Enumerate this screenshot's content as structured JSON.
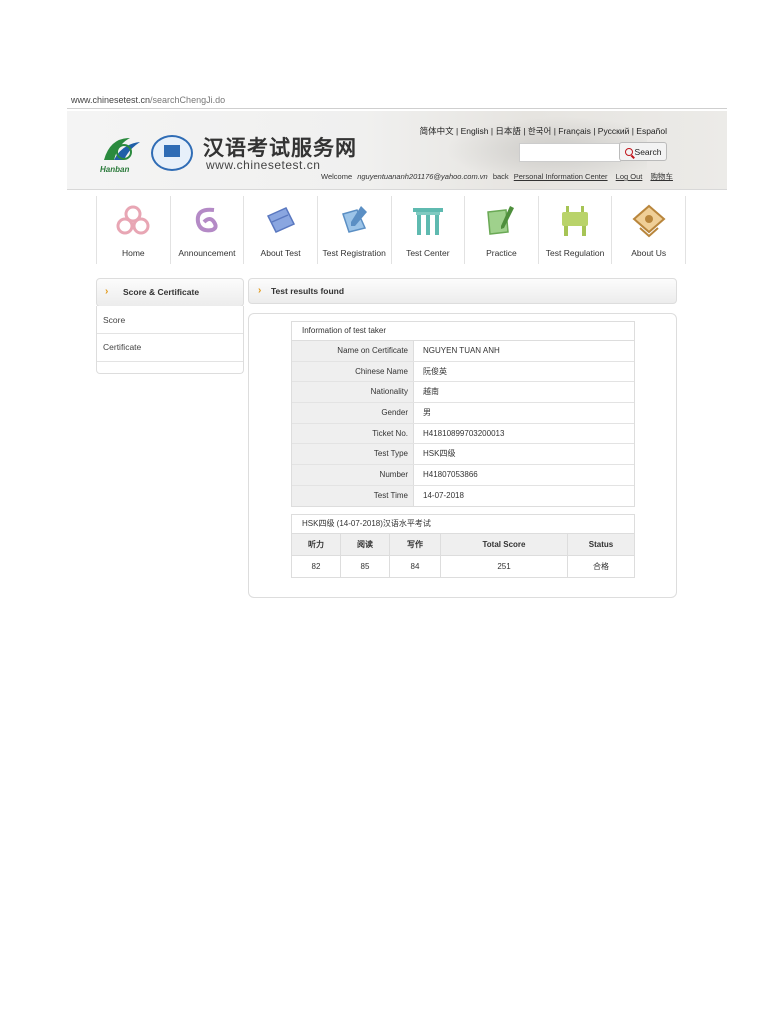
{
  "url": {
    "domain": "www.chinesetest.cn",
    "path": "/searchChengJi.do"
  },
  "header": {
    "logo_text": "Hanban",
    "site_name_cn": "汉语考试服务网",
    "site_name_en": "www.chinesetest.cn",
    "languages": [
      "简体中文",
      "English",
      "日本語",
      "한국어",
      "Français",
      "Русский",
      "Español"
    ],
    "search_button": "Search",
    "search_placeholder": "",
    "welcome": "Welcome",
    "email": "nguyentuananh201176@yahoo.com.vn",
    "back": "back",
    "personal_center": "Personal Information Center",
    "logout": "Log Out",
    "cart": "购物车"
  },
  "nav": {
    "items": [
      {
        "label": "Home",
        "icon": "home-icon",
        "color": "#e8a6b4"
      },
      {
        "label": "Announcement",
        "icon": "announcement-icon",
        "color": "#b48ac6"
      },
      {
        "label": "About Test",
        "icon": "about-test-icon",
        "color": "#6f8fd6"
      },
      {
        "label": "Test Registration",
        "icon": "test-registration-icon",
        "color": "#6fa8dc"
      },
      {
        "label": "Test Center",
        "icon": "test-center-icon",
        "color": "#5fbab0"
      },
      {
        "label": "Practice",
        "icon": "practice-icon",
        "color": "#7fbf6a"
      },
      {
        "label": "Test Regulation",
        "icon": "test-regulation-icon",
        "color": "#a6c455"
      },
      {
        "label": "About Us",
        "icon": "about-us-icon",
        "color": "#d8a75a"
      }
    ]
  },
  "sidebar": {
    "title": "Score & Certificate",
    "items": [
      "Score",
      "Certificate"
    ]
  },
  "main": {
    "title": "Test results found",
    "info": {
      "caption": "Information of test taker",
      "rows": [
        {
          "k": "Name on Certificate",
          "v": "NGUYEN TUAN ANH"
        },
        {
          "k": "Chinese Name",
          "v": "阮俊英"
        },
        {
          "k": "Nationality",
          "v": "越南"
        },
        {
          "k": "Gender",
          "v": "男"
        },
        {
          "k": "Ticket No.",
          "v": "H41810899703200013"
        },
        {
          "k": "Test Type",
          "v": "HSK四级"
        },
        {
          "k": "Number",
          "v": "H41807053866"
        },
        {
          "k": "Test Time",
          "v": "14-07-2018"
        }
      ]
    },
    "score": {
      "caption": "HSK四级 (14-07-2018)汉语水平考试",
      "headers": [
        "听力",
        "阅读",
        "写作",
        "Total Score",
        "Status"
      ],
      "values": [
        "82",
        "85",
        "84",
        "251",
        "合格"
      ]
    }
  }
}
